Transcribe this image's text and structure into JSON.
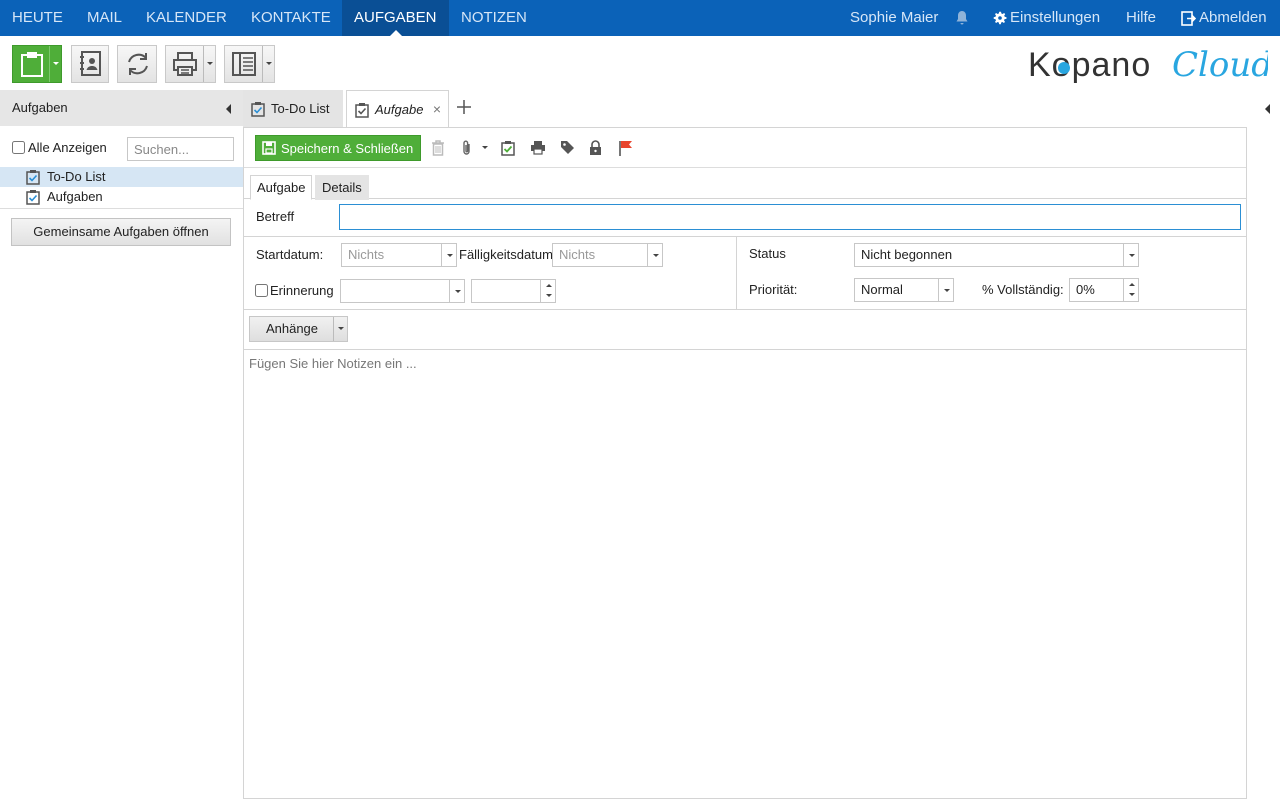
{
  "nav": {
    "items": [
      {
        "label": "HEUTE"
      },
      {
        "label": "MAIL"
      },
      {
        "label": "KALENDER"
      },
      {
        "label": "KONTAKTE"
      },
      {
        "label": "AUFGABEN",
        "active": true
      },
      {
        "label": "NOTIZEN"
      }
    ],
    "user": "Sophie Maier",
    "settings": "Einstellungen",
    "help": "Hilfe",
    "logout": "Abmelden"
  },
  "brand": {
    "name": "Kopano Cloud"
  },
  "left_panel": {
    "title": "Aufgaben",
    "show_all": "Alle Anzeigen",
    "search_placeholder": "Suchen...",
    "folders": [
      {
        "label": "To-Do List",
        "selected": true
      },
      {
        "label": "Aufgaben",
        "selected": false
      }
    ],
    "open_shared": "Gemeinsame Aufgaben öffnen"
  },
  "tabs": [
    {
      "label": "To-Do List",
      "active": false
    },
    {
      "label": "Aufgabe",
      "active": true
    }
  ],
  "form": {
    "save_close": "Speichern & Schließen",
    "subtabs": [
      "Aufgabe",
      "Details"
    ],
    "betreff_label": "Betreff",
    "betreff_value": "",
    "start_label": "Startdatum:",
    "start_value": "Nichts",
    "due_label": "Fälligkeitsdatum:",
    "due_value": "Nichts",
    "reminder_label": "Erinnerung",
    "status_label": "Status",
    "status_value": "Nicht begonnen",
    "priority_label": "Priorität:",
    "priority_value": "Normal",
    "complete_label": "% Vollständig:",
    "complete_value": "0%",
    "attachments": "Anhänge",
    "notes_placeholder": "Fügen Sie hier Notizen ein ..."
  },
  "colors": {
    "nav_bg": "#0b62b8",
    "nav_active": "#0a4f95",
    "accent_green": "#4fae39",
    "selection": "#d6e6f4"
  }
}
